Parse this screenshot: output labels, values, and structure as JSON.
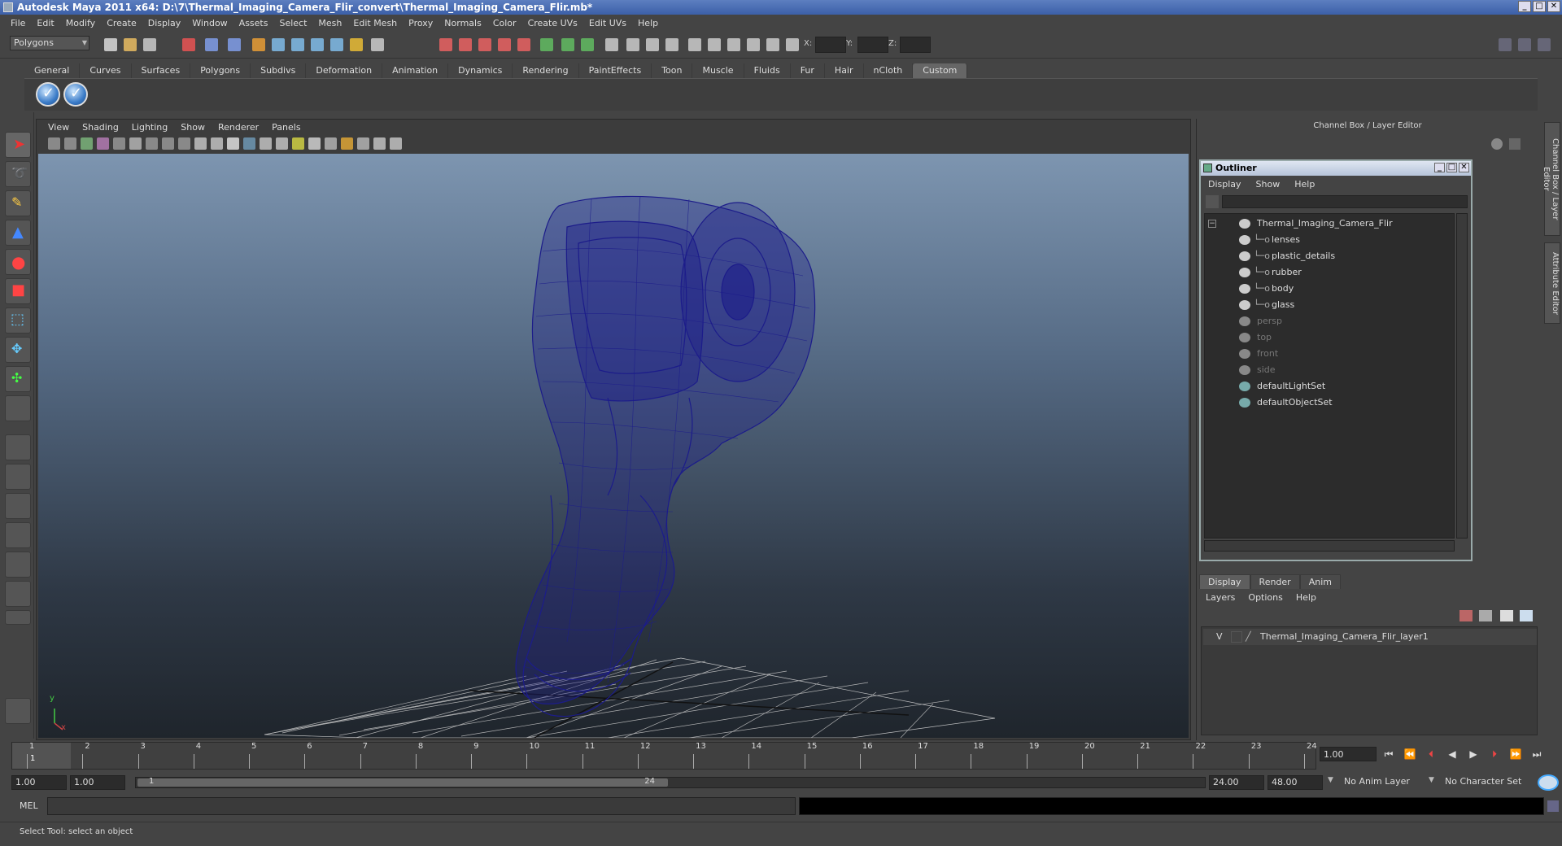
{
  "window": {
    "title": "Autodesk Maya 2011 x64: D:\\7\\Thermal_Imaging_Camera_Flir_convert\\Thermal_Imaging_Camera_Flir.mb*"
  },
  "menubar": [
    "File",
    "Edit",
    "Modify",
    "Create",
    "Display",
    "Window",
    "Assets",
    "Select",
    "Mesh",
    "Edit Mesh",
    "Proxy",
    "Normals",
    "Color",
    "Create UVs",
    "Edit UVs",
    "Help"
  ],
  "status_line": {
    "mode": "Polygons",
    "x_label": "X:",
    "y_label": "Y:",
    "z_label": "Z:"
  },
  "shelf": {
    "tabs": [
      "General",
      "Curves",
      "Surfaces",
      "Polygons",
      "Subdivs",
      "Deformation",
      "Animation",
      "Dynamics",
      "Rendering",
      "PaintEffects",
      "Toon",
      "Muscle",
      "Fluids",
      "Fur",
      "Hair",
      "nCloth",
      "Custom"
    ],
    "active_tab": "Custom"
  },
  "viewport": {
    "menu": [
      "View",
      "Shading",
      "Lighting",
      "Show",
      "Renderer",
      "Panels"
    ],
    "axis_y": "y",
    "axis_x": "x",
    "wire_color": "#1c1c8a"
  },
  "channel_box": {
    "title": "Channel Box / Layer Editor",
    "side_tabs": [
      "Channel Box / Layer Editor",
      "Attribute Editor"
    ]
  },
  "outliner": {
    "title": "Outliner",
    "menu": [
      "Display",
      "Show",
      "Help"
    ],
    "items": [
      {
        "label": "Thermal_Imaging_Camera_Flir",
        "indent": 0,
        "dim": false
      },
      {
        "label": "lenses",
        "indent": 1,
        "dim": false
      },
      {
        "label": "plastic_details",
        "indent": 1,
        "dim": false
      },
      {
        "label": "rubber",
        "indent": 1,
        "dim": false
      },
      {
        "label": "body",
        "indent": 1,
        "dim": false
      },
      {
        "label": "glass",
        "indent": 1,
        "dim": false
      },
      {
        "label": "persp",
        "indent": 0,
        "dim": true
      },
      {
        "label": "top",
        "indent": 0,
        "dim": true
      },
      {
        "label": "front",
        "indent": 0,
        "dim": true
      },
      {
        "label": "side",
        "indent": 0,
        "dim": true
      },
      {
        "label": "defaultLightSet",
        "indent": 0,
        "dim": false
      },
      {
        "label": "defaultObjectSet",
        "indent": 0,
        "dim": false
      }
    ]
  },
  "layer_editor": {
    "tabs": [
      "Display",
      "Render",
      "Anim"
    ],
    "active_tab": "Display",
    "menu": [
      "Layers",
      "Options",
      "Help"
    ],
    "layers": [
      {
        "visible": "V",
        "name": "Thermal_Imaging_Camera_Flir_layer1"
      }
    ]
  },
  "time_slider": {
    "ticks": [
      "1",
      "2",
      "3",
      "4",
      "5",
      "6",
      "7",
      "8",
      "9",
      "10",
      "11",
      "12",
      "13",
      "14",
      "15",
      "16",
      "17",
      "18",
      "19",
      "20",
      "21",
      "22",
      "23",
      "24"
    ],
    "current_frame": "1",
    "current_field": "1.00"
  },
  "range_slider": {
    "start": "1.00",
    "start2": "1.00",
    "range_start": "1",
    "range_end": "24",
    "end": "24.00",
    "end2": "48.00",
    "anim_layer": "No Anim Layer",
    "character_set": "No Character Set"
  },
  "command_line": {
    "label": "MEL"
  },
  "help_line": "Select Tool: select an object"
}
